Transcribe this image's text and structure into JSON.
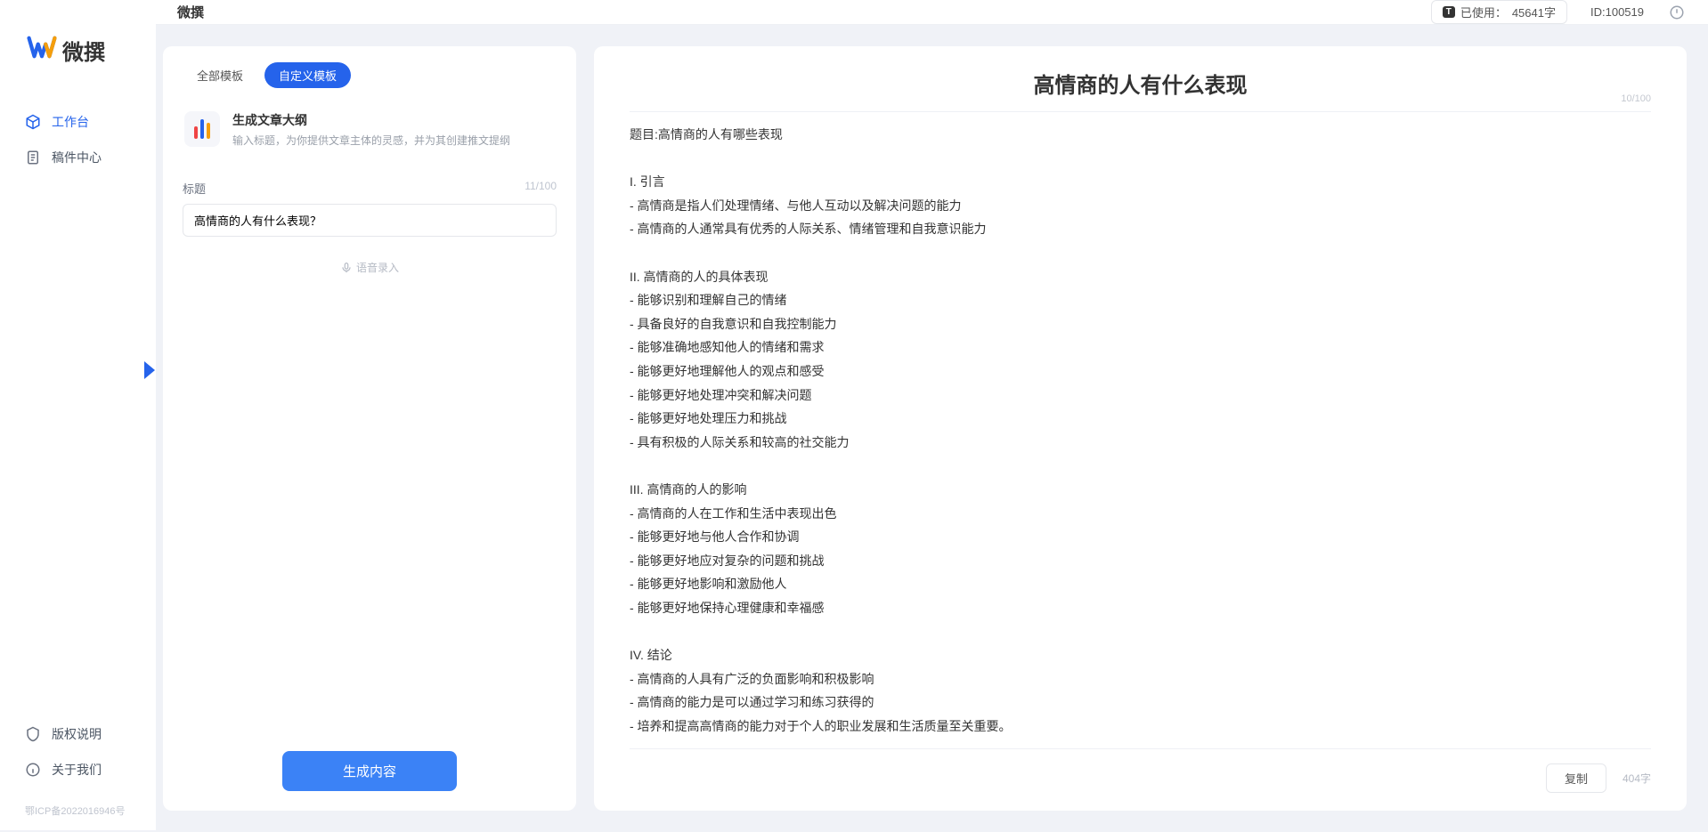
{
  "brand": {
    "name": "微撰"
  },
  "sidebar": {
    "nav": [
      {
        "label": "工作台",
        "icon": "cube-icon",
        "active": true
      },
      {
        "label": "稿件中心",
        "icon": "document-icon",
        "active": false
      }
    ],
    "bottom": [
      {
        "label": "版权说明",
        "icon": "shield-icon"
      },
      {
        "label": "关于我们",
        "icon": "info-icon"
      }
    ],
    "icp": "鄂ICP备2022016946号"
  },
  "topbar": {
    "title": "微撰",
    "usage_prefix": "已使用：",
    "usage_value": "45641字",
    "id_prefix": "ID:",
    "id_value": "100519"
  },
  "left_panel": {
    "tabs": [
      {
        "label": "全部模板",
        "active": false
      },
      {
        "label": "自定义模板",
        "active": true
      }
    ],
    "template": {
      "title": "生成文章大纲",
      "desc": "输入标题，为你提供文章主体的灵感，并为其创建推文提纲"
    },
    "field_label": "标题",
    "field_count": "11/100",
    "input_value": "高情商的人有什么表现？",
    "voice_hint": "语音录入",
    "generate_btn": "生成内容"
  },
  "right_panel": {
    "heading": "高情商的人有什么表现",
    "top_count": "10/100",
    "body": "题目:高情商的人有哪些表现\n\nI. 引言\n- 高情商是指人们处理情绪、与他人互动以及解决问题的能力\n- 高情商的人通常具有优秀的人际关系、情绪管理和自我意识能力\n\nII. 高情商的人的具体表现\n- 能够识别和理解自己的情绪\n- 具备良好的自我意识和自我控制能力\n- 能够准确地感知他人的情绪和需求\n- 能够更好地理解他人的观点和感受\n- 能够更好地处理冲突和解决问题\n- 能够更好地处理压力和挑战\n- 具有积极的人际关系和较高的社交能力\n\nIII. 高情商的人的影响\n- 高情商的人在工作和生活中表现出色\n- 能够更好地与他人合作和协调\n- 能够更好地应对复杂的问题和挑战\n- 能够更好地影响和激励他人\n- 能够更好地保持心理健康和幸福感\n\nIV. 结论\n- 高情商的人具有广泛的负面影响和积极影响\n- 高情商的能力是可以通过学习和练习获得的\n- 培养和提高高情商的能力对于个人的职业发展和生活质量至关重要。",
    "copy_btn": "复制",
    "word_count": "404字"
  }
}
